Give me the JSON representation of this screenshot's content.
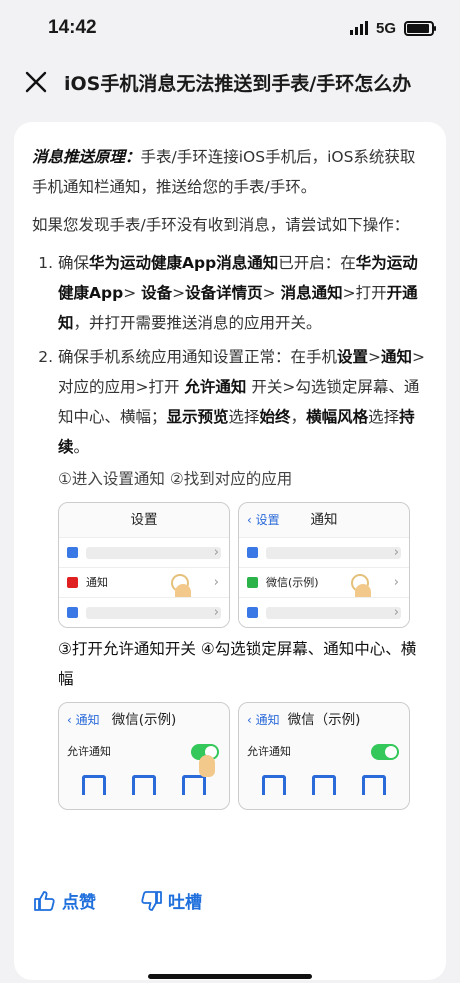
{
  "status": {
    "time": "14:42",
    "network": "5G",
    "battery_level": 0.9
  },
  "header": {
    "title": "iOS手机消息无法推送到手表/手环怎么办"
  },
  "article": {
    "principle_label": "消息推送原理：",
    "principle_text": "手表/手环连接iOS手机后，iOS系统获取手机通知栏通知，推送给您的手表/手环。",
    "intro": "如果您发现手表/手环没有收到消息，请尝试如下操作：",
    "step1": {
      "t1": "确保",
      "b1": "华为运动健康App消息通知",
      "t2": "已开启：在",
      "b2": "华为运动健康App",
      "t3": "> ",
      "b3": "设备",
      "t4": ">",
      "b4": "设备详情页",
      "t5": "> ",
      "b5": "消息通知",
      "t6": ">打开",
      "b6": "开通知",
      "t7": "，并打开需要推送消息的应用开关。"
    },
    "step2": {
      "t1": "确保手机系统应用通知设置正常：在手机",
      "b1": "设置",
      "t2": ">",
      "b2": "通知",
      "t3": ">对应的应用>打开 ",
      "b3": "允许通知",
      "t4": " 开关>勾选锁定屏幕、通知中心、横幅；",
      "b4": "显示预览",
      "t5": "选择",
      "b5": "始终",
      "t6": "，",
      "b6": "横幅风格",
      "t7": "选择",
      "b7": "持续",
      "t8": "。"
    },
    "caption1": "①进入设置通知 ②找到对应的应用",
    "caption2": "③打开允许通知开关 ④勾选锁定屏幕、通知中心、横幅",
    "shot1": {
      "title": "设置",
      "row_label": "通知"
    },
    "shot2": {
      "back": "设置",
      "title": "通知",
      "row_label": "微信(示例)"
    },
    "shot3": {
      "back": "通知",
      "title": "微信(示例)",
      "row_label": "允许通知"
    },
    "shot4": {
      "back": "通知",
      "title": "微信（示例)",
      "row_label": "允许通知"
    }
  },
  "actions": {
    "like": "点赞",
    "dislike": "吐槽"
  },
  "colors": {
    "accent": "#1f6fdc",
    "toggle": "#34c759",
    "red": "#e02020",
    "green": "#2bb34a",
    "blue": "#3a78e6"
  }
}
